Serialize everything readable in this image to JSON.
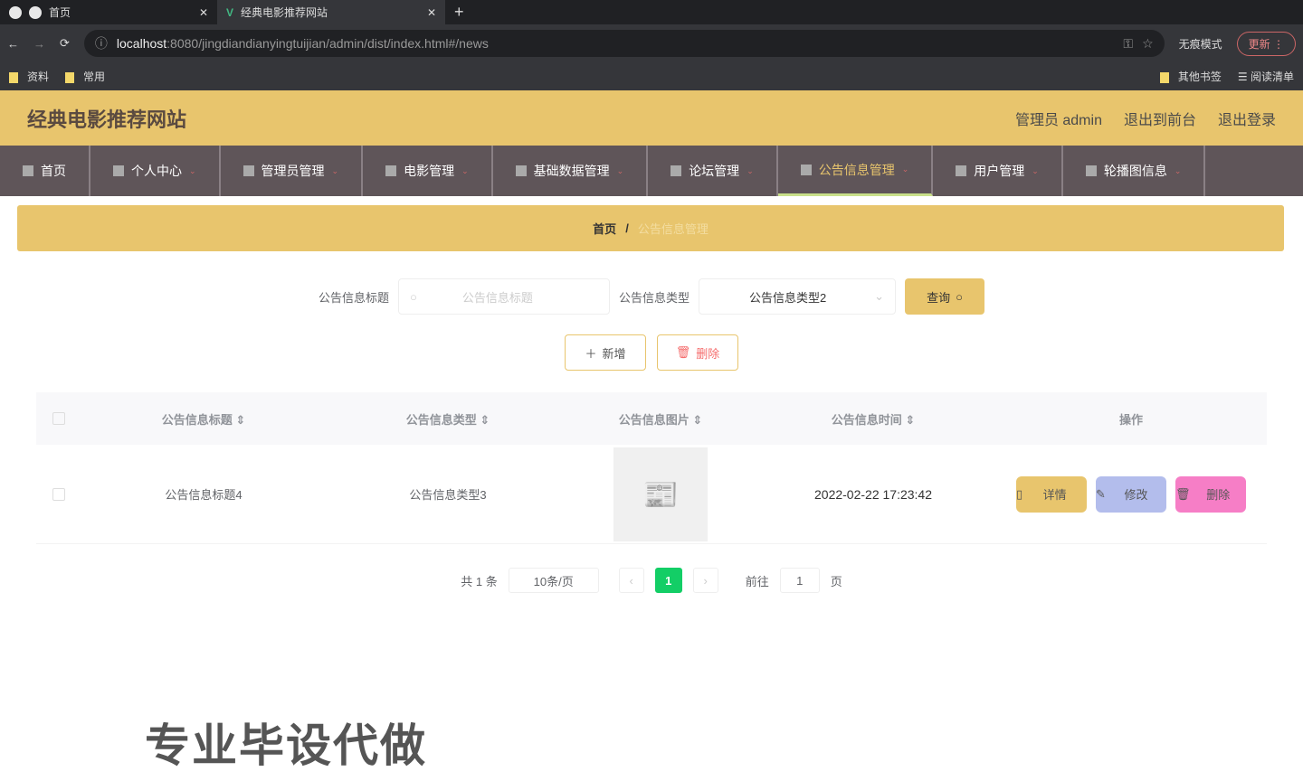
{
  "browser": {
    "tabs": [
      {
        "label": "首页"
      },
      {
        "label": "经典电影推荐网站"
      }
    ],
    "url_host": "localhost",
    "url_rest": ":8080/jingdiandianyingtuijian/admin/dist/index.html#/news",
    "incognito": "无痕模式",
    "update": "更新",
    "bookmarks": [
      "资料",
      "常用"
    ],
    "other_bookmarks": "其他书签",
    "reading_list": "阅读清单"
  },
  "header": {
    "title": "经典电影推荐网站",
    "user": "管理员 admin",
    "front": "退出到前台",
    "logout": "退出登录"
  },
  "nav": [
    "首页",
    "个人中心",
    "管理员管理",
    "电影管理",
    "基础数据管理",
    "论坛管理",
    "公告信息管理",
    "用户管理",
    "轮播图信息"
  ],
  "breadcrumb": {
    "home": "首页",
    "sep": "/",
    "current": "公告信息管理"
  },
  "search": {
    "title_label": "公告信息标题",
    "title_placeholder": "公告信息标题",
    "type_label": "公告信息类型",
    "type_value": "公告信息类型2",
    "query": "查询"
  },
  "actions": {
    "add": "新增",
    "delete": "删除"
  },
  "table": {
    "headers": [
      "公告信息标题",
      "公告信息类型",
      "公告信息图片",
      "公告信息时间",
      "操作"
    ],
    "rows": [
      {
        "title": "公告信息标题4",
        "type": "公告信息类型3",
        "time": "2022-02-22 17:23:42"
      }
    ],
    "ops": {
      "detail": "详情",
      "edit": "修改",
      "delete": "删除"
    }
  },
  "pager": {
    "total": "共 1 条",
    "size": "10条/页",
    "current": "1",
    "goto": "前往",
    "goto_value": "1",
    "page": "页"
  },
  "watermark": "专业毕设代做"
}
